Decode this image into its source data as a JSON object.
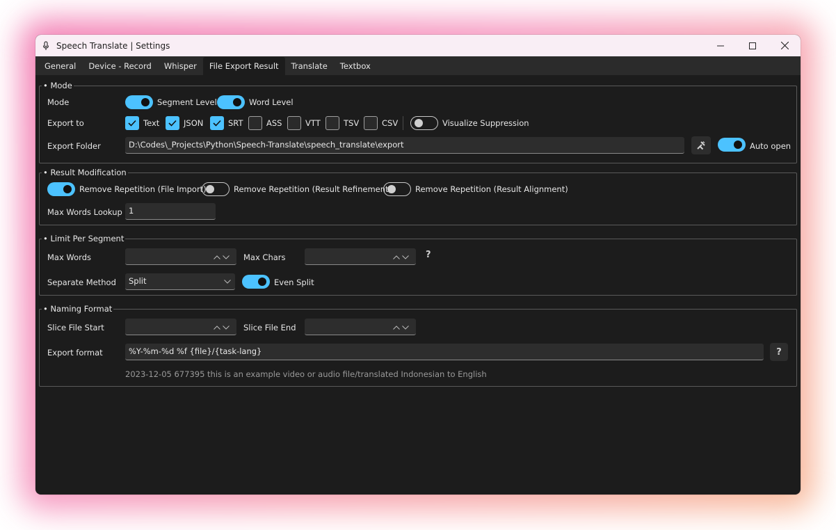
{
  "window": {
    "title": "Speech Translate | Settings",
    "icon": "microphone-icon"
  },
  "tabs": [
    {
      "label": "General"
    },
    {
      "label": "Device - Record"
    },
    {
      "label": "Whisper"
    },
    {
      "label": "File Export Result",
      "active": true
    },
    {
      "label": "Translate"
    },
    {
      "label": "Textbox"
    }
  ],
  "mode_group": {
    "legend": "• Mode",
    "mode_label": "Mode",
    "segment_level": {
      "label": "Segment Level",
      "on": true
    },
    "word_level": {
      "label": "Word Level",
      "on": true
    },
    "export_to_label": "Export to",
    "formats": [
      {
        "label": "Text",
        "checked": true
      },
      {
        "label": "JSON",
        "checked": true
      },
      {
        "label": "SRT",
        "checked": true
      },
      {
        "label": "ASS",
        "checked": false
      },
      {
        "label": "VTT",
        "checked": false
      },
      {
        "label": "TSV",
        "checked": false
      },
      {
        "label": "CSV",
        "checked": false
      }
    ],
    "visualize_suppression": {
      "label": "Visualize Suppression",
      "on": false
    },
    "export_folder_label": "Export Folder",
    "export_folder_value": "D:\\Codes\\_Projects\\Python\\Speech-Translate\\speech_translate\\export",
    "auto_open": {
      "label": "Auto open",
      "on": true
    }
  },
  "result_group": {
    "legend": "• Result Modification",
    "remove_file_import": {
      "label": "Remove Repetition (File Import)",
      "on": true
    },
    "remove_refinement": {
      "label": "Remove Repetition (Result Refinement)",
      "on": false
    },
    "remove_alignment": {
      "label": "Remove Repetition (Result Alignment)",
      "on": false
    },
    "max_words_lookup_label": "Max Words Lookup",
    "max_words_lookup_value": "1"
  },
  "limit_group": {
    "legend": "• Limit Per Segment",
    "max_words_label": "Max Words",
    "max_words_value": "",
    "max_chars_label": "Max Chars",
    "max_chars_value": "",
    "help": "?",
    "separate_method_label": "Separate Method",
    "separate_method_value": "Split",
    "even_split": {
      "label": "Even Split",
      "on": true
    }
  },
  "naming_group": {
    "legend": "• Naming Format",
    "slice_start_label": "Slice File Start",
    "slice_start_value": "",
    "slice_end_label": "Slice File End",
    "slice_end_value": "",
    "export_format_label": "Export format",
    "export_format_value": "%Y-%m-%d %f {file}/{task-lang}",
    "help": "?",
    "example": "2023-12-05 677395 this is an example video or audio file/translated Indonesian to English"
  },
  "colors": {
    "accent": "#4cc2ff",
    "window_bg": "#1c1c1c",
    "titlebar_bg": "#f9eef5"
  }
}
